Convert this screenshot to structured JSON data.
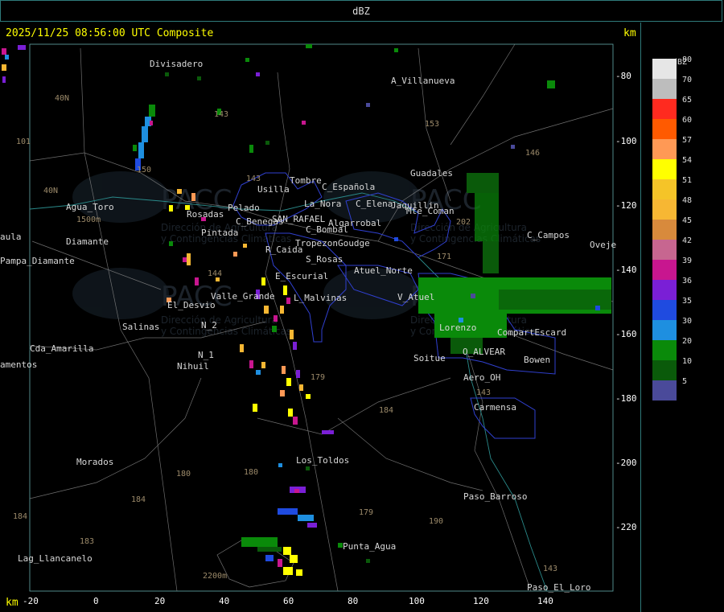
{
  "window": {
    "title": "dBZ"
  },
  "header": {
    "timestamp": "2025/11/25 08:56:00 UTC Composite",
    "unit": "km"
  },
  "axes": {
    "unit": "km",
    "x_ticks": [
      "-20",
      "0",
      "20",
      "40",
      "60",
      "80",
      "100",
      "120",
      "140"
    ],
    "y_ticks": [
      "-80",
      "-100",
      "-120",
      "-140",
      "-160",
      "-180",
      "-200",
      "-220"
    ]
  },
  "places": [
    "Divisadero",
    "A_Villanueva",
    "Guadales",
    "Tombre",
    "C_Española",
    "Usilla",
    "La_Nora",
    "C_Elena",
    "Jaquillin",
    "Mte_Coman",
    "C_Benegas",
    "SAN_RAFAEL",
    "Algarrobal",
    "C_Bombal",
    "Pintada",
    "Tropezon",
    "Goudge",
    "C_Campos",
    "Oveje",
    "R_Caida",
    "S_Rosas",
    "Atuel_Norte",
    "E_Escurial",
    "Valle_Grande",
    "L_Malvinas",
    "V_Atuel",
    "El_Desvio",
    "Salinas",
    "Lorenzo",
    "CompartEscard",
    "O_ALVEAR",
    "Bowen",
    "Cda_Amarilla",
    "N_2",
    "N_1",
    "Nihuil",
    "Soitue",
    "Aero_OH",
    "Carmensa",
    "Morados",
    "Los_Toldos",
    "Paso_Barroso",
    "Punta_Agua",
    "Lag_Llancanelo",
    "Paso_El_Loro",
    "Agua_Toro",
    "Pampa_Diamante",
    "aula",
    "amentos",
    "Diamante",
    "Rosadas",
    "Pelado"
  ],
  "routes": [
    "40N",
    "101",
    "40N",
    "143",
    "143",
    "153",
    "146",
    "202",
    "171",
    "144",
    "150",
    "179",
    "184",
    "180",
    "184",
    "180",
    "179",
    "190",
    "184",
    "183",
    "143",
    "143"
  ],
  "elevations": [
    "1500m",
    "2200m"
  ],
  "watermark": {
    "brand": "PACC",
    "line1": "Dirección de Agricultura",
    "line2": "y Contingencias Climáticas"
  },
  "legend": {
    "title": "dBZ",
    "items": [
      {
        "label": "80",
        "color": "#e6e6e6"
      },
      {
        "label": "70",
        "color": "#bdbdbd"
      },
      {
        "label": "65",
        "color": "#ff2a1f"
      },
      {
        "label": "60",
        "color": "#ff5a00"
      },
      {
        "label": "57",
        "color": "#ff9955"
      },
      {
        "label": "54",
        "color": "#ffff00"
      },
      {
        "label": "51",
        "color": "#f5c428"
      },
      {
        "label": "48",
        "color": "#f7b733"
      },
      {
        "label": "45",
        "color": "#d88a3c"
      },
      {
        "label": "42",
        "color": "#c76690"
      },
      {
        "label": "39",
        "color": "#c8168f"
      },
      {
        "label": "36",
        "color": "#7a1fd6"
      },
      {
        "label": "35",
        "color": "#1f4be0"
      },
      {
        "label": "30",
        "color": "#1e8fe0"
      },
      {
        "label": "20",
        "color": "#0a8a0a"
      },
      {
        "label": "10",
        "color": "#0a5a0a"
      },
      {
        "label": "5",
        "color": "#4a4a9a"
      }
    ]
  }
}
